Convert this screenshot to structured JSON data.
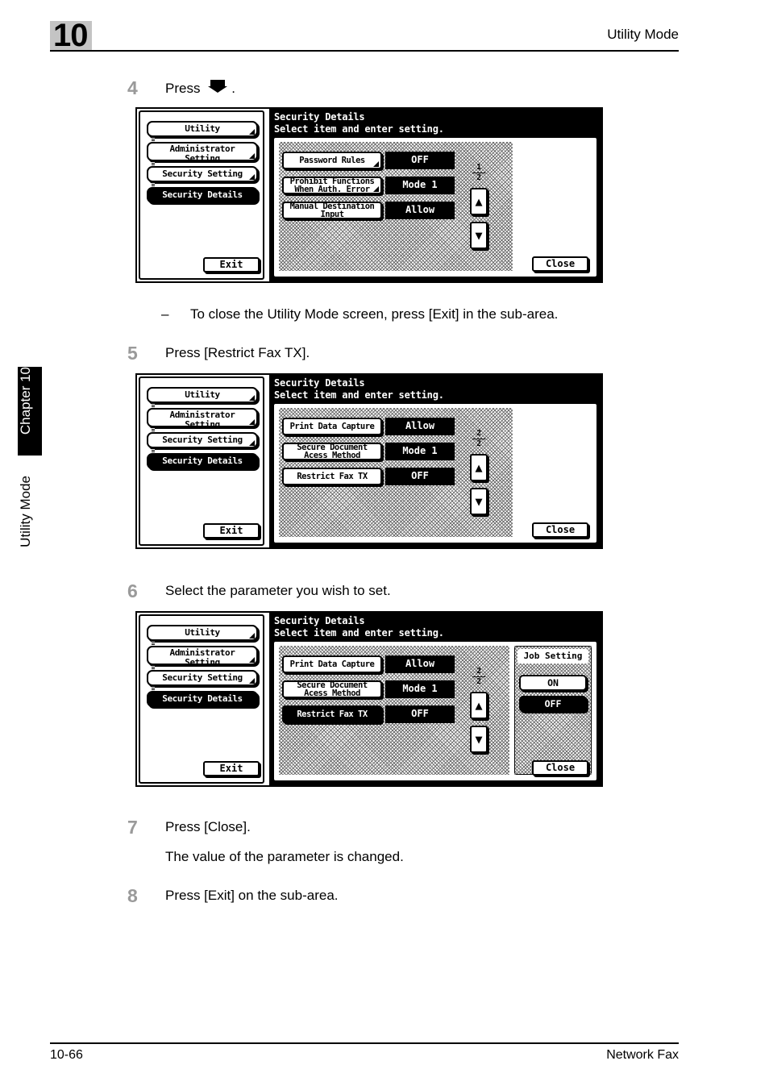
{
  "header": {
    "chapter_number": "10",
    "title": "Utility Mode"
  },
  "footer": {
    "page": "10-66",
    "title": "Network Fax"
  },
  "side_tab": {
    "chapter": "Chapter 10",
    "section": "Utility Mode"
  },
  "steps": [
    {
      "number": "4",
      "text_before": "Press",
      "icon": "down-arrow-icon",
      "text_after": "."
    },
    {
      "number": "5",
      "text": "Press [Restrict Fax TX]."
    },
    {
      "number": "6",
      "text": "Select the parameter you wish to set."
    },
    {
      "number": "7",
      "text": "Press [Close].",
      "detail": "The value of the parameter is changed."
    },
    {
      "number": "8",
      "text": "Press [Exit] on the sub-area."
    }
  ],
  "note": {
    "dash": "–",
    "text": "To close the Utility Mode screen, press [Exit] in the sub-area."
  },
  "panels": [
    {
      "id": "panel-step4",
      "nav": {
        "items": [
          {
            "label": "Utility",
            "selected": false,
            "arrow": true
          },
          {
            "label_line1": "Administrator",
            "label_line2": "Setting",
            "selected": false,
            "arrow": true
          },
          {
            "label": "Security Setting",
            "selected": false,
            "arrow": true
          },
          {
            "label": "Security Details",
            "selected": true,
            "arrow": false
          }
        ],
        "exit_label": "Exit"
      },
      "title": "Security Details",
      "subtitle": "Select item and enter setting.",
      "rows": [
        {
          "label": "Password Rules",
          "value": "OFF",
          "arrow": true,
          "selected": false
        },
        {
          "label_line1": "Prohibit Functions",
          "label_line2": "When Auth. Error",
          "value": "Mode 1",
          "arrow": true,
          "selected": false
        },
        {
          "label_line1": "Manual Destination",
          "label_line2": "Input",
          "value": "Allow",
          "arrow": false,
          "selected": false
        }
      ],
      "pager": {
        "current": "1",
        "total": "2"
      },
      "scroll_up": "▲",
      "scroll_down": "▼",
      "job_column": null,
      "close_label": "Close"
    },
    {
      "id": "panel-step5",
      "nav": {
        "items": [
          {
            "label": "Utility",
            "selected": false,
            "arrow": true
          },
          {
            "label_line1": "Administrator",
            "label_line2": "Setting",
            "selected": false,
            "arrow": true
          },
          {
            "label": "Security Setting",
            "selected": false,
            "arrow": true
          },
          {
            "label": "Security Details",
            "selected": true,
            "arrow": false
          }
        ],
        "exit_label": "Exit"
      },
      "title": "Security Details",
      "subtitle": "Select item and enter setting.",
      "rows": [
        {
          "label": "Print Data Capture",
          "value": "Allow",
          "arrow": false,
          "selected": false
        },
        {
          "label_line1": "Secure Document",
          "label_line2": "Acess Method",
          "value": "Mode 1",
          "arrow": false,
          "selected": false
        },
        {
          "label": "Restrict Fax TX",
          "value": "OFF",
          "arrow": false,
          "selected": false
        }
      ],
      "pager": {
        "current": "2",
        "total": "2"
      },
      "scroll_up": "▲",
      "scroll_down": "▼",
      "job_column": null,
      "close_label": "Close"
    },
    {
      "id": "panel-step6",
      "nav": {
        "items": [
          {
            "label": "Utility",
            "selected": false,
            "arrow": true
          },
          {
            "label_line1": "Administrator",
            "label_line2": "Setting",
            "selected": false,
            "arrow": true
          },
          {
            "label": "Security Setting",
            "selected": false,
            "arrow": true
          },
          {
            "label": "Security Details",
            "selected": true,
            "arrow": false
          }
        ],
        "exit_label": "Exit"
      },
      "title": "Security Details",
      "subtitle": "Select item and enter setting.",
      "rows": [
        {
          "label": "Print Data Capture",
          "value": "Allow",
          "arrow": false,
          "selected": false
        },
        {
          "label_line1": "Secure Document",
          "label_line2": "Acess Method",
          "value": "Mode 1",
          "arrow": false,
          "selected": false
        },
        {
          "label": "Restrict Fax TX",
          "value": "OFF",
          "arrow": false,
          "selected": true
        }
      ],
      "pager": {
        "current": "2",
        "total": "2"
      },
      "scroll_up": "▲",
      "scroll_down": "▼",
      "job_column": {
        "title": "Job Setting",
        "options": [
          {
            "label": "ON",
            "selected": false
          },
          {
            "label": "OFF",
            "selected": true
          }
        ]
      },
      "close_label": "Close"
    }
  ],
  "colors": {
    "badge_gray": "#c4c4c4",
    "step_number_gray": "#9a9a9a",
    "ink": "#000000",
    "paper": "#ffffff"
  }
}
